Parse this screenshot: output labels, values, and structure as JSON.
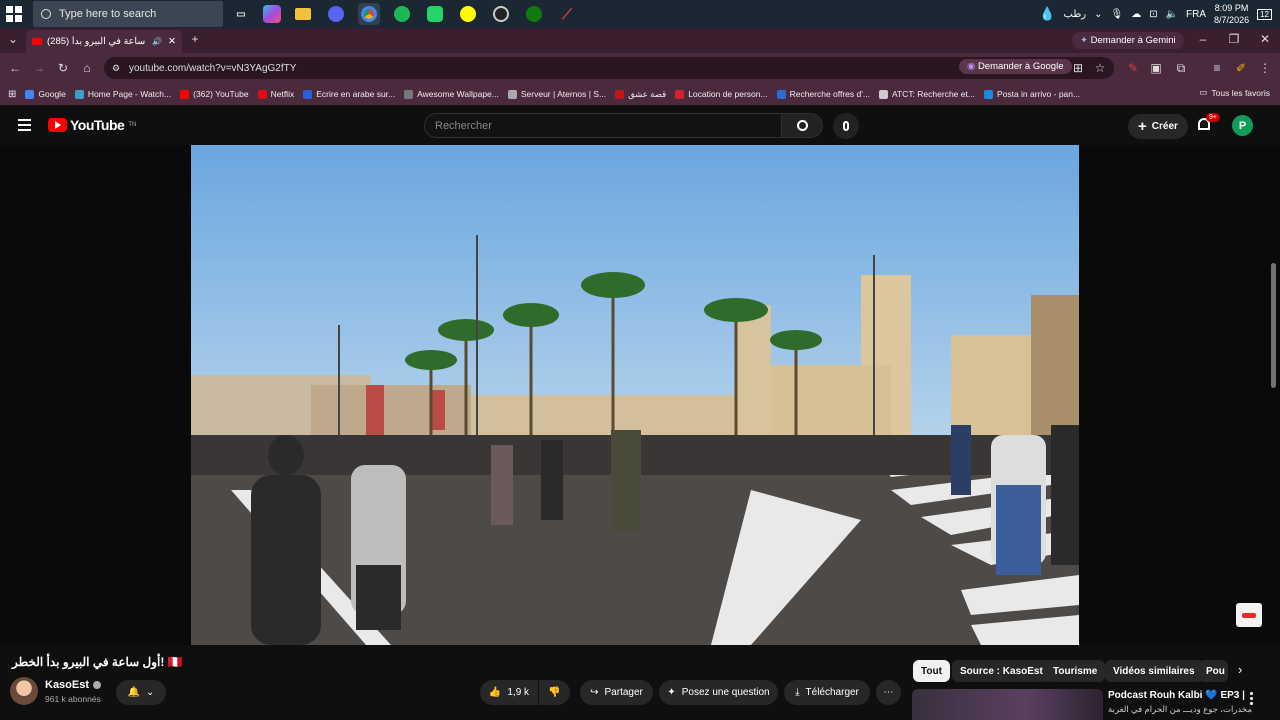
{
  "taskbar": {
    "search_placeholder": "Type here to search",
    "apps": [
      "task-view",
      "copilot",
      "file-explorer",
      "discord",
      "chrome",
      "spotify",
      "whatsapp",
      "snapchat",
      "epic",
      "xbox",
      "app"
    ],
    "weather": "رطب",
    "lang": "FRA",
    "time": "8:09 PM",
    "date": "8/7/2026",
    "notif_count": "12"
  },
  "browser": {
    "tab_title": "(285) أول ساعة في البيرو بدأ",
    "gemini_label": "Demander à Gemini",
    "url": "youtube.com/watch?v=vN3YAgG2fTY",
    "ask_google_label": "Demander à Google",
    "bookmarks": [
      {
        "label": "Google",
        "color": "#4285f4"
      },
      {
        "label": "Home Page - Watch...",
        "color": "#3aa0c8"
      },
      {
        "label": "(362) YouTube",
        "color": "#ff0000"
      },
      {
        "label": "Netflix",
        "color": "#e50914"
      },
      {
        "label": "Ecrire en arabe sur...",
        "color": "#2a5fd8"
      },
      {
        "label": "Awesome Wallpape...",
        "color": "#777777"
      },
      {
        "label": "Serveur | Aternos | S...",
        "color": "#aaaaaa"
      },
      {
        "label": "قصة عشق",
        "color": "#c01818"
      },
      {
        "label": "Location de person...",
        "color": "#d1202f"
      },
      {
        "label": "Recherche offres d'...",
        "color": "#2e6bd1"
      },
      {
        "label": "ATCT: Recherche et...",
        "color": "#cccccc"
      },
      {
        "label": "Posta in arrivo - pan...",
        "color": "#1e88e5"
      }
    ],
    "all_bookmarks": "Tous les favoris"
  },
  "youtube": {
    "logo_text": "YouTube",
    "logo_suffix": "TN",
    "search_placeholder": "Rechercher",
    "create_label": "Créer",
    "notif_badge": "9+",
    "avatar_initial": "P",
    "video_title": "أول ساعة في البيرو بدأ الخطر! 🇵🇪",
    "channel": "KasoEst",
    "subscribers": "961 k abonnés",
    "likes": "1,9 k",
    "share_label": "Partager",
    "ask_label": "Posez une question",
    "download_label": "Télécharger",
    "chips": [
      "Tout",
      "Source : KasoEst",
      "Tourisme",
      "Vidéos similaires",
      "Pou"
    ],
    "suggestion": {
      "title": "Podcast Rouh Kalbi 💙 EP3 |",
      "subtitle": "مخدرات، جوع وديـــ من الحرام في الغربة"
    }
  }
}
